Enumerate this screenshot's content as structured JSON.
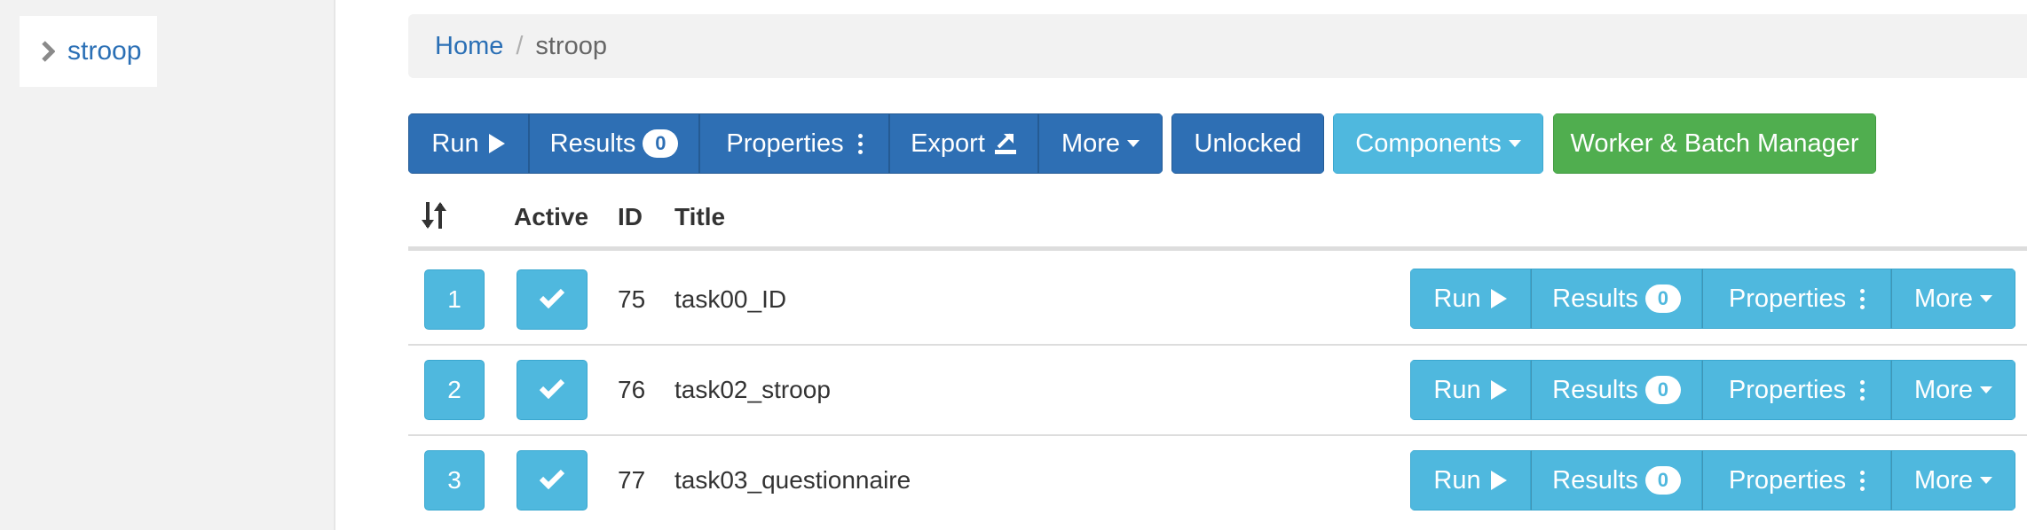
{
  "sidebar": {
    "items": [
      {
        "label": "stroop",
        "icon": "chevron-right-icon"
      }
    ]
  },
  "breadcrumb": {
    "home": "Home",
    "separator": "/",
    "current": "stroop"
  },
  "toolbar": {
    "run_label": "Run",
    "results_label": "Results",
    "results_count": "0",
    "properties_label": "Properties",
    "export_label": "Export",
    "more_label": "More",
    "unlocked_label": "Unlocked",
    "components_label": "Components",
    "worker_batch_label": "Worker & Batch Manager"
  },
  "table": {
    "columns": {
      "sort": "sort-icon",
      "active": "Active",
      "id": "ID",
      "title": "Title"
    },
    "rows": [
      {
        "position": "1",
        "active": true,
        "id": "75",
        "title": "task00_ID",
        "run_label": "Run",
        "results_label": "Results",
        "results_count": "0",
        "properties_label": "Properties",
        "more_label": "More"
      },
      {
        "position": "2",
        "active": true,
        "id": "76",
        "title": "task02_stroop",
        "run_label": "Run",
        "results_label": "Results",
        "results_count": "0",
        "properties_label": "Properties",
        "more_label": "More"
      },
      {
        "position": "3",
        "active": true,
        "id": "77",
        "title": "task03_questionnaire",
        "run_label": "Run",
        "results_label": "Results",
        "results_count": "0",
        "properties_label": "Properties",
        "more_label": "More"
      }
    ]
  },
  "colors": {
    "primary": "#2e6fb4",
    "info": "#4fb8de",
    "success": "#50ae4f",
    "link": "#2a6fb5"
  }
}
